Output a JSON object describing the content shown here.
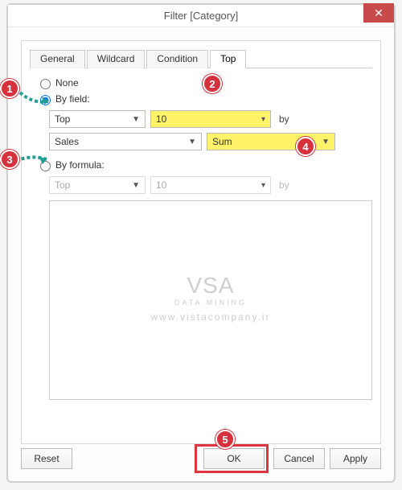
{
  "title": "Filter [Category]",
  "tabs": [
    "General",
    "Wildcard",
    "Condition",
    "Top"
  ],
  "active_tab": "Top",
  "options": {
    "none": "None",
    "by_field": "By field:",
    "by_formula": "By formula:"
  },
  "byfield": {
    "direction": "Top",
    "count": "10",
    "by": "by",
    "field": "Sales",
    "agg": "Sum"
  },
  "byformula": {
    "direction": "Top",
    "count": "10",
    "by": "by"
  },
  "buttons": {
    "reset": "Reset",
    "ok": "OK",
    "cancel": "Cancel",
    "apply": "Apply"
  },
  "callouts": [
    "1",
    "2",
    "3",
    "4",
    "5"
  ],
  "watermark": {
    "logo": "VSA",
    "tag": "DATA MINING",
    "url": "www.vistacompany.ir"
  }
}
